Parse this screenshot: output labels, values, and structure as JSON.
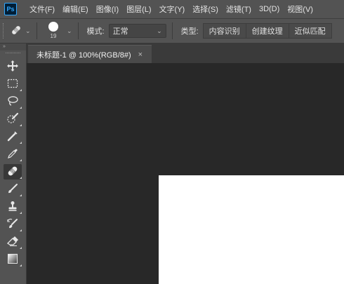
{
  "app": {
    "logo_text": "Ps"
  },
  "menu": [
    {
      "label": "文件(F)"
    },
    {
      "label": "编辑(E)"
    },
    {
      "label": "图像(I)"
    },
    {
      "label": "图层(L)"
    },
    {
      "label": "文字(Y)"
    },
    {
      "label": "选择(S)"
    },
    {
      "label": "滤镜(T)"
    },
    {
      "label": "3D(D)"
    },
    {
      "label": "视图(V)"
    }
  ],
  "options": {
    "brush_size": "19",
    "mode_label": "模式:",
    "mode_value": "正常",
    "type_label": "类型:",
    "type_buttons": [
      "内容识别",
      "创建纹理",
      "近似匹配"
    ]
  },
  "document": {
    "tab_title": "未标题-1 @ 100%(RGB/8#)",
    "close_glyph": "×"
  },
  "toolbar": {
    "collapse_glyph": "»",
    "tools": [
      {
        "name": "move-tool",
        "icon": "move-icon",
        "active": false
      },
      {
        "name": "marquee-tool",
        "icon": "marquee-icon",
        "active": false
      },
      {
        "name": "lasso-tool",
        "icon": "lasso-icon",
        "active": false
      },
      {
        "name": "quick-selection-tool",
        "icon": "quick-selection-icon",
        "active": false
      },
      {
        "name": "crop-tool",
        "icon": "crop-icon",
        "active": false
      },
      {
        "name": "eyedropper-tool",
        "icon": "eyedropper-icon",
        "active": false
      },
      {
        "name": "spot-healing-brush-tool",
        "icon": "bandage-icon",
        "active": true
      },
      {
        "name": "brush-tool",
        "icon": "brush-icon",
        "active": false
      },
      {
        "name": "clone-stamp-tool",
        "icon": "stamp-icon",
        "active": false
      },
      {
        "name": "history-brush-tool",
        "icon": "history-brush-icon",
        "active": false
      },
      {
        "name": "eraser-tool",
        "icon": "eraser-icon",
        "active": false
      },
      {
        "name": "gradient-tool",
        "icon": "gradient-icon",
        "active": false
      }
    ]
  },
  "colors": {
    "chrome": "#535353",
    "canvas_bg": "#282828",
    "document_bg": "#ffffff",
    "ps_blue": "#31a8ff"
  }
}
